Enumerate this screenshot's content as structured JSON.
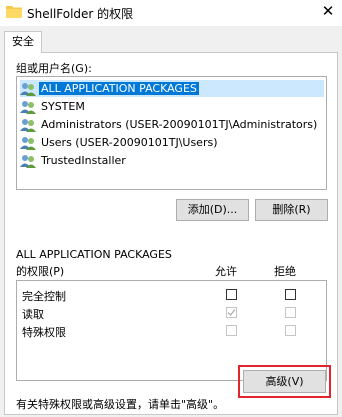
{
  "window": {
    "title": "ShellFolder 的权限"
  },
  "tabs": [
    {
      "label": "安全"
    }
  ],
  "users_section": {
    "label": "组或用户名(G):",
    "items": [
      {
        "name": "ALL APPLICATION PACKAGES",
        "icon": "group-users-icon",
        "selected": true
      },
      {
        "name": "SYSTEM",
        "icon": "group-users-icon"
      },
      {
        "name": "Administrators (USER-20090101TJ\\Administrators)",
        "icon": "group-users-icon"
      },
      {
        "name": "Users (USER-20090101TJ\\Users)",
        "icon": "group-users-icon"
      },
      {
        "name": "TrustedInstaller",
        "icon": "group-users-icon"
      }
    ]
  },
  "buttons": {
    "add": "添加(D)...",
    "remove": "删除(R)",
    "advanced": "高级(V)"
  },
  "permissions_section": {
    "label_line1": "ALL APPLICATION PACKAGES",
    "label_line2": "的权限(P)",
    "allow_header": "允许",
    "deny_header": "拒绝",
    "rows": [
      {
        "name": "完全控制",
        "allow": false,
        "deny": false,
        "disabled": false
      },
      {
        "name": "读取",
        "allow": true,
        "deny": false,
        "disabled": true
      },
      {
        "name": "特殊权限",
        "allow": false,
        "deny": false,
        "disabled": true
      }
    ]
  },
  "advanced_hint": "有关特殊权限或高级设置，请单击\"高级\"。",
  "colors": {
    "selection": "#0078d7",
    "highlight_outline": "#e0262c"
  }
}
